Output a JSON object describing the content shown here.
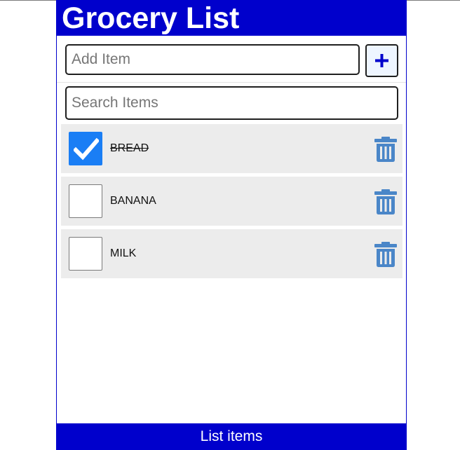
{
  "header": {
    "title": "Grocery List"
  },
  "add": {
    "placeholder": "Add Item",
    "value": "",
    "button_icon": "plus-icon"
  },
  "search": {
    "placeholder": "Search Items",
    "value": ""
  },
  "items": [
    {
      "name": "BREAD",
      "checked": true
    },
    {
      "name": "BANANA",
      "checked": false
    },
    {
      "name": "MILK",
      "checked": false
    }
  ],
  "footer": {
    "label": "List items"
  },
  "colors": {
    "brand": "#0000cc",
    "checkbox_checked": "#1a7ef5",
    "trash_icon": "#4a86c8",
    "row_background": "#ececec"
  }
}
